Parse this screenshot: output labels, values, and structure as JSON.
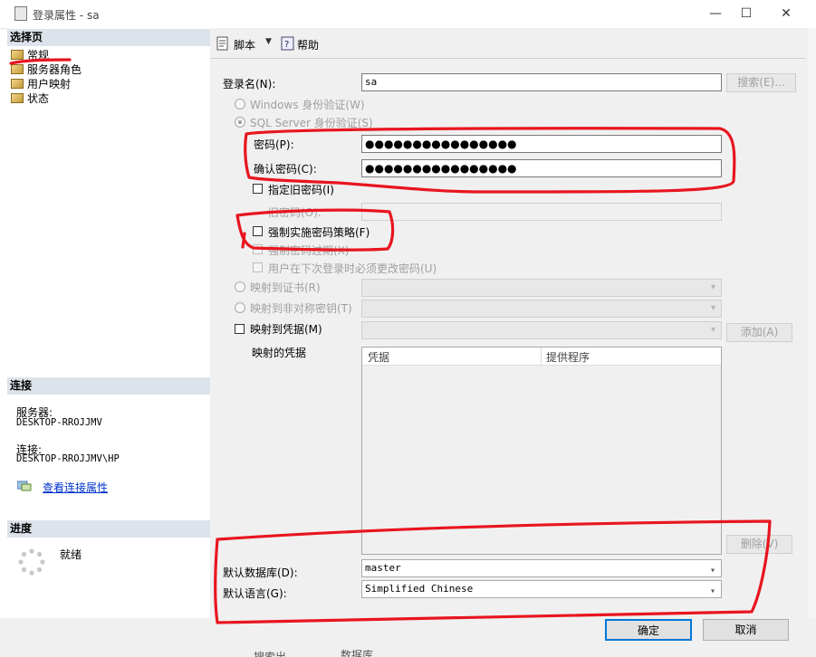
{
  "window": {
    "title": "登录属性 - sa",
    "minimize": "—",
    "maximize": "☐",
    "close": "✕"
  },
  "sidebar": {
    "select_page_header": "选择页",
    "items": [
      {
        "label": "常规"
      },
      {
        "label": "服务器角色"
      },
      {
        "label": "用户映射"
      },
      {
        "label": "状态"
      }
    ],
    "connection_header": "连接",
    "server_label": "服务器:",
    "server_value": "DESKTOP-RROJJMV",
    "connection_label": "连接:",
    "connection_value": "DESKTOP-RROJJMV\\HP",
    "view_connection_link": "查看连接属性",
    "progress_header": "进度",
    "progress_status": "就绪"
  },
  "toolbar": {
    "script_label": "脚本",
    "help_label": "帮助"
  },
  "form": {
    "login_name_label": "登录名(N):",
    "login_name_value": "sa",
    "search_button": "搜索(E)...",
    "windows_auth_label": "Windows 身份验证(W)",
    "sql_auth_label": "SQL Server 身份验证(S)",
    "password_label": "密码(P):",
    "password_value": "●●●●●●●●●●●●●●●●",
    "confirm_password_label": "确认密码(C):",
    "confirm_password_value": "●●●●●●●●●●●●●●●●",
    "specify_old_password_label": "指定旧密码(I)",
    "old_password_label": "旧密码(O):",
    "enforce_policy_label": "强制实施密码策略(F)",
    "enforce_expiration_label": "强制密码过期(X)",
    "must_change_label": "用户在下次登录时必须更改密码(U)",
    "map_certificate_label": "映射到证书(R)",
    "map_asym_key_label": "映射到非对称密钥(T)",
    "map_credential_label": "映射到凭据(M)",
    "add_button": "添加(A)",
    "mapped_credentials_label": "映射的凭据",
    "grid_columns": [
      "凭据",
      "提供程序"
    ],
    "remove_button": "删除(V)",
    "default_db_label": "默认数据库(D):",
    "default_db_value": "master",
    "default_lang_label": "默认语言(G):",
    "default_lang_value": "Simplified Chinese"
  },
  "footer": {
    "ok_button": "确定",
    "cancel_button": "取消"
  },
  "background_fragments": [
    "搜索出",
    "数据库"
  ],
  "colors": {
    "annotation_red": "#e8151f",
    "section_header": "#dde3ea",
    "panel_bg": "#f0f0f0",
    "ok_border": "#0078d7"
  }
}
